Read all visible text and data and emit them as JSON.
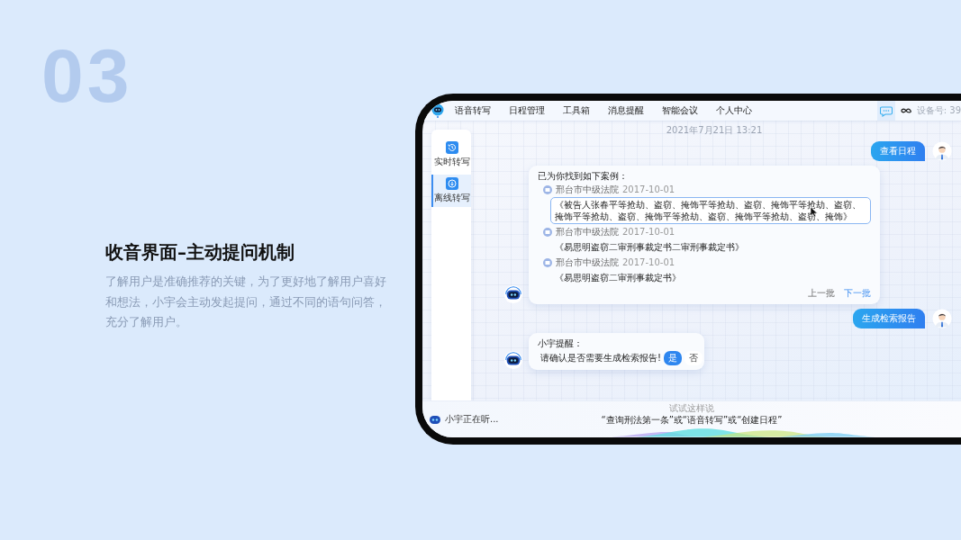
{
  "slide": {
    "number": "03",
    "title": "收音界面–主动提问机制",
    "description": "了解用户是准确推荐的关键，为了更好地了解用户喜好和想法，小宇会主动发起提问，通过不同的语句问答，充分了解用户。"
  },
  "app": {
    "nav": {
      "items": [
        "语音转写",
        "日程管理",
        "工具箱",
        "消息提醒",
        "智能会议",
        "个人中心"
      ],
      "device_label": "设备号: 39"
    },
    "sidebar": {
      "items": [
        {
          "label": "实时转写",
          "kind": "realtime",
          "selected": false
        },
        {
          "label": "离线转写",
          "kind": "offline",
          "selected": true
        }
      ]
    },
    "chat": {
      "timestamp": "2021年7月21日 13:21",
      "messages": [
        {
          "kind": "user",
          "text": "查看日程"
        },
        {
          "kind": "cases",
          "heading": "已为你找到如下案例：",
          "cases": [
            {
              "court": "邢台市中级法院",
              "date": "2017-10-01",
              "title": "《被告人张春平等抢劫、盗窃、掩饰平等抢劫、盗窃、掩饰平等抢劫、盗窃、掩饰平等抢劫、盗窃、掩饰平等抢劫、盗窃、掩饰平等抢劫、盗窃、掩饰》",
              "selected": true
            },
            {
              "court": "邢台市中级法院",
              "date": "2017-10-01",
              "title": "《易思明盗窃二审刑事裁定书二审刑事裁定书》",
              "selected": false
            },
            {
              "court": "邢台市中级法院",
              "date": "2017-10-01",
              "title": "《易思明盗窃二审刑事裁定书》",
              "selected": false
            }
          ],
          "prev": "上一批",
          "next": "下一批"
        },
        {
          "kind": "user",
          "text": "生成检索报告"
        },
        {
          "kind": "prompt",
          "heading": "小宇提醒：",
          "question": "请确认是否需要生成检索报告!",
          "options": [
            {
              "label": "是",
              "selected": true
            },
            {
              "label": "否",
              "selected": false
            }
          ]
        }
      ]
    },
    "listen_bar": {
      "status": "小宇正在听...",
      "hint_label": "试试这样说",
      "hint": "“查询刑法第一条”或“语音转写”或“创建日程”"
    }
  }
}
